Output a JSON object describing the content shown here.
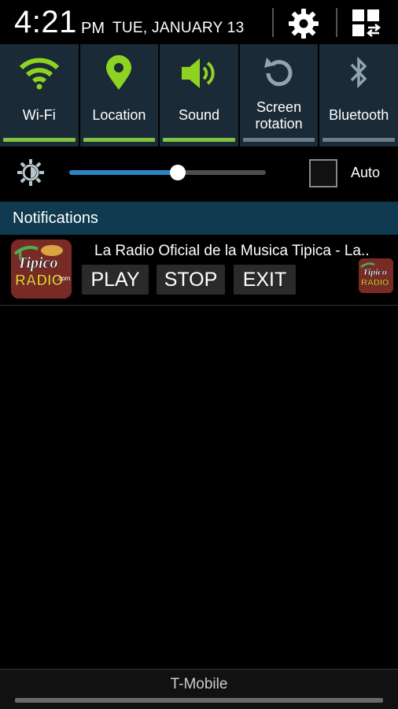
{
  "header": {
    "time": "4:21",
    "ampm": "PM",
    "date": "TUE, JANUARY 13",
    "settings_icon": "gear-icon",
    "toggle_icon": "grid-toggle-icon"
  },
  "quick_settings": [
    {
      "label": "Wi-Fi",
      "icon": "wifi-icon",
      "state": "on"
    },
    {
      "label": "Location",
      "icon": "location-pin-icon",
      "state": "on"
    },
    {
      "label": "Sound",
      "icon": "speaker-icon",
      "state": "on"
    },
    {
      "label_line1": "Screen",
      "label_line2": "rotation",
      "icon": "rotation-icon",
      "state": "off"
    },
    {
      "label": "Bluetooth",
      "icon": "bluetooth-icon",
      "state": "off"
    }
  ],
  "brightness": {
    "level": 0.55,
    "auto_label": "Auto",
    "auto_checked": false
  },
  "notifications": {
    "title": "Notifications",
    "items": [
      {
        "text": "La Radio Oficial de la Musica Tipica - La..",
        "buttons": [
          "PLAY",
          "STOP",
          "EXIT"
        ],
        "logo": "tipico-radio-logo"
      }
    ]
  },
  "bottom": {
    "carrier": "T-Mobile"
  },
  "colors": {
    "active_green": "#7fc242",
    "inactive_gray": "#6c7d88",
    "tile_bg": "#1a2a36",
    "notif_header_bg": "#0f3a4f",
    "slider_blue": "#2b86c4"
  }
}
